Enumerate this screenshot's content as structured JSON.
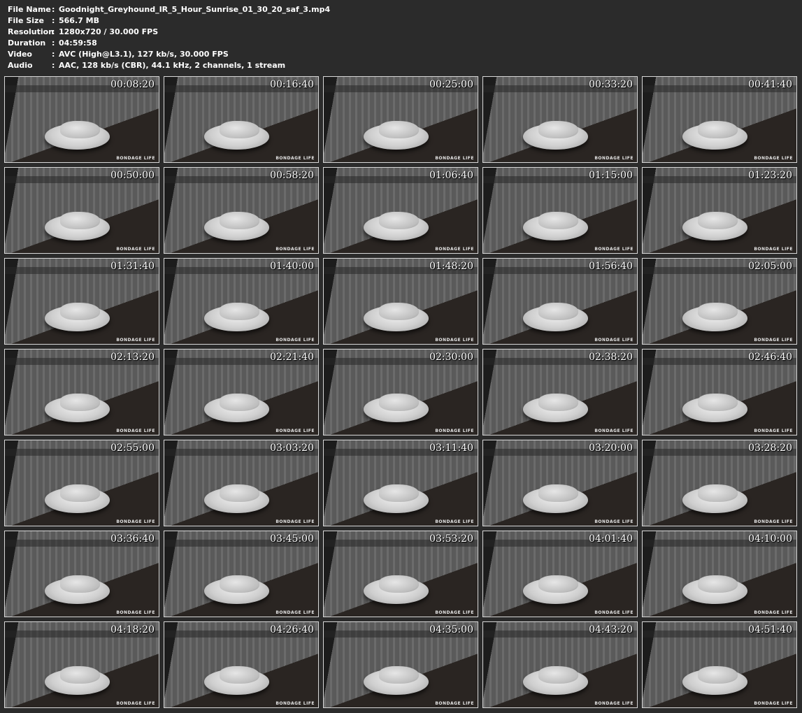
{
  "info": [
    {
      "label": "File Name",
      "sep": ":",
      "value": "Goodnight_Greyhound_IR_5_Hour_Sunrise_01_30_20_saf_3.mp4"
    },
    {
      "label": "File Size",
      "sep": ":",
      "value": "566.7 MB"
    },
    {
      "label": "Resolution",
      "sep": ":",
      "value": "1280x720 / 30.000 FPS"
    },
    {
      "label": "Duration",
      "sep": ":",
      "value": "04:59:58"
    },
    {
      "label": "Video",
      "sep": ":",
      "value": "AVC (High@L3.1), 127 kb/s, 30.000 FPS"
    },
    {
      "label": "Audio",
      "sep": ":",
      "value": "AAC, 128 kb/s (CBR), 44.1 kHz, 2 channels, 1 stream"
    }
  ],
  "watermark": "BONDAGE LIFE",
  "thumbnails": [
    "00:08:20",
    "00:16:40",
    "00:25:00",
    "00:33:20",
    "00:41:40",
    "00:50:00",
    "00:58:20",
    "01:06:40",
    "01:15:00",
    "01:23:20",
    "01:31:40",
    "01:40:00",
    "01:48:20",
    "01:56:40",
    "02:05:00",
    "02:13:20",
    "02:21:40",
    "02:30:00",
    "02:38:20",
    "02:46:40",
    "02:55:00",
    "03:03:20",
    "03:11:40",
    "03:20:00",
    "03:28:20",
    "03:36:40",
    "03:45:00",
    "03:53:20",
    "04:01:40",
    "04:10:00",
    "04:18:20",
    "04:26:40",
    "04:35:00",
    "04:43:20",
    "04:51:40"
  ]
}
